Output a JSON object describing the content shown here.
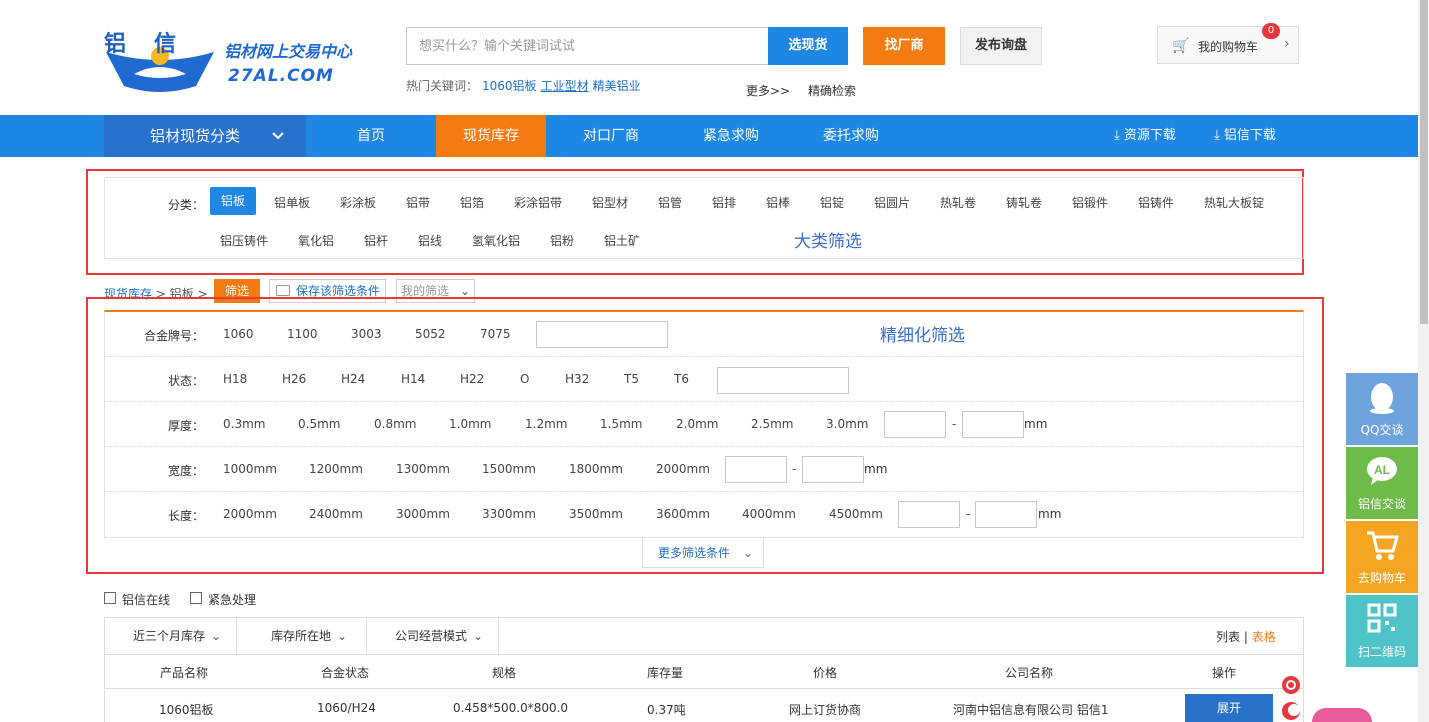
{
  "header": {
    "logo_cn": "铝信",
    "logo_sub": "铝材网上交易中心",
    "logo_en": "27AL.COM",
    "search_placeholder": "想买什么？输个关键词试试",
    "btn_spot": "选现货",
    "btn_factory": "找厂商",
    "btn_inquiry": "发布询盘",
    "hot_label": "热门关键词：",
    "hot_keywords": [
      "1060铝板",
      "工业型材",
      "精美铝业"
    ],
    "more": "更多>>",
    "precise": "精确检索",
    "cart_label": "我的购物车",
    "cart_count": "0"
  },
  "nav": {
    "category": "铝材现货分类",
    "items": [
      "首页",
      "现货库存",
      "对口厂商",
      "紧急求购",
      "委托求购"
    ],
    "downloads": [
      "资源下载",
      "铝信下载"
    ]
  },
  "categories": {
    "label": "分类：",
    "row1": [
      "铝板",
      "铝单板",
      "彩涂板",
      "铝带",
      "铝箔",
      "彩涂铝带",
      "铝型材",
      "铝管",
      "铝排",
      "铝棒",
      "铝锭",
      "铝圆片",
      "热轧卷",
      "铸轧卷",
      "铝锻件",
      "铝铸件",
      "热轧大板锭"
    ],
    "row2": [
      "铝压铸件",
      "氧化铝",
      "铝杆",
      "铝线",
      "氢氧化铝",
      "铝粉",
      "铝土矿"
    ],
    "annotation": "大类筛选"
  },
  "breadcrumb": {
    "link": "现货库存",
    "current": "铝板",
    "sep": ">",
    "filter_btn": "筛选",
    "save_btn": "保存该筛选条件",
    "my_filter": "我的筛选"
  },
  "detail": {
    "annotation": "精细化筛选",
    "alloy_label": "合金牌号：",
    "alloy": [
      "1060",
      "1100",
      "3003",
      "5052",
      "7075"
    ],
    "state_label": "状态：",
    "state": [
      "H18",
      "H26",
      "H24",
      "H14",
      "H22",
      "O",
      "H32",
      "T5",
      "T6"
    ],
    "thick_label": "厚度：",
    "thick": [
      "0.3mm",
      "0.5mm",
      "0.8mm",
      "1.0mm",
      "1.2mm",
      "1.5mm",
      "2.0mm",
      "2.5mm",
      "3.0mm"
    ],
    "width_label": "宽度：",
    "width": [
      "1000mm",
      "1200mm",
      "1300mm",
      "1500mm",
      "1800mm",
      "2000mm"
    ],
    "length_label": "长度：",
    "length": [
      "2000mm",
      "2400mm",
      "3000mm",
      "3300mm",
      "3500mm",
      "3600mm",
      "4000mm",
      "4500mm"
    ],
    "dash": "-",
    "unit": "mm",
    "more": "更多筛选条件"
  },
  "checks": [
    "铝信在线",
    "紧急处理"
  ],
  "table": {
    "dropdowns": [
      "近三个月库存",
      "库存所在地",
      "公司经营模式"
    ],
    "view_list": "列表",
    "view_sep": "|",
    "view_table": "表格",
    "headers": [
      "产品名称",
      "合金状态",
      "规格",
      "库存量",
      "价格",
      "公司名称",
      "操作"
    ],
    "rows": [
      [
        "1060铝板",
        "1060/H24",
        "0.458*500.0*800.0",
        "0.37吨",
        "网上订货协商",
        "河南中铝信息有限公司 铝信1",
        "展开"
      ]
    ]
  },
  "side": [
    "QQ交谈",
    "铝信交谈",
    "去购物车",
    "扫二维码"
  ],
  "colors": {
    "blue": "#1e87e4",
    "orange": "#f47b12",
    "red": "#e5393a"
  }
}
